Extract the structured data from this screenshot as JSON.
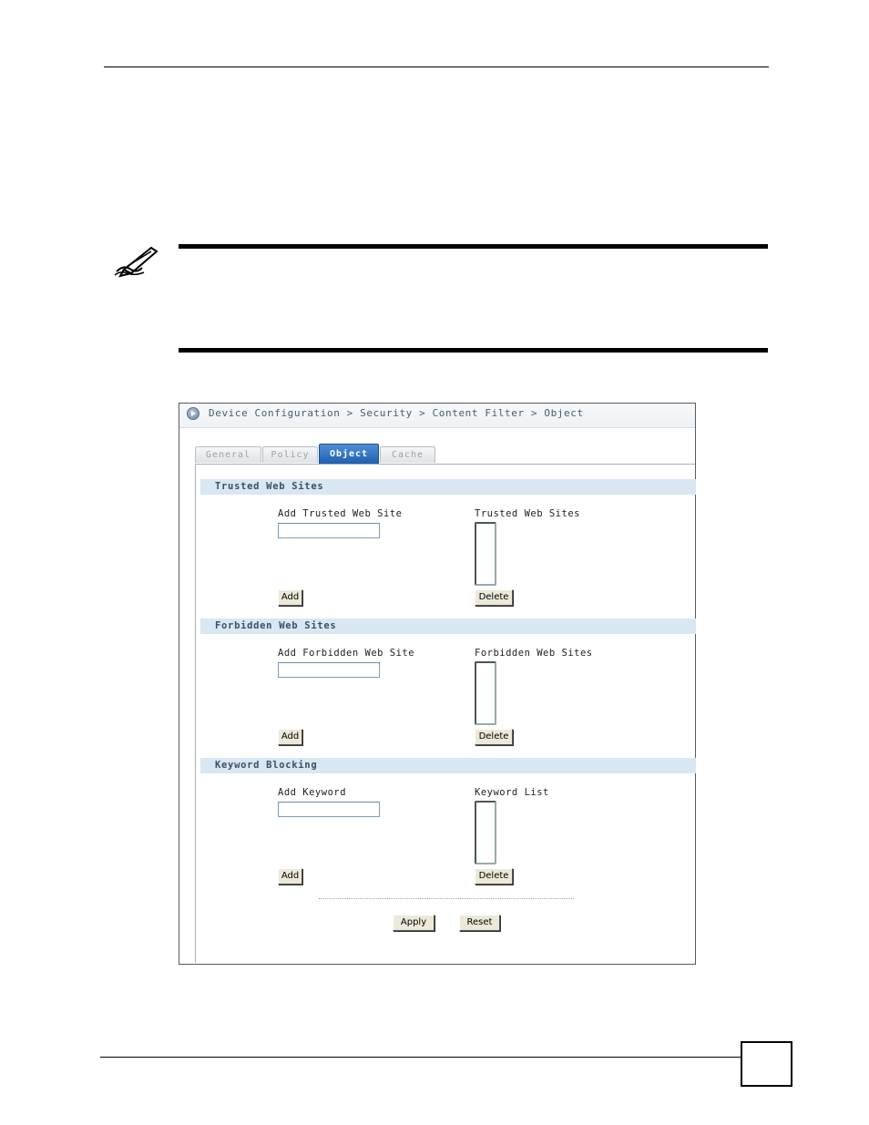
{
  "breadcrumb": {
    "text": "Device Configuration > Security > Content Filter > Object"
  },
  "tabs": [
    {
      "label": "General",
      "active": false
    },
    {
      "label": "Policy",
      "active": false
    },
    {
      "label": "Object",
      "active": true
    },
    {
      "label": "Cache",
      "active": false
    }
  ],
  "sections": {
    "trusted": {
      "header": "Trusted Web Sites",
      "add_label": "Add Trusted Web Site",
      "add_value": "",
      "list_label": "Trusted Web Sites",
      "add_button": "Add",
      "delete_button": "Delete"
    },
    "forbidden": {
      "header": "Forbidden Web Sites",
      "add_label": "Add Forbidden Web Site",
      "add_value": "",
      "list_label": "Forbidden Web Sites",
      "add_button": "Add",
      "delete_button": "Delete"
    },
    "keyword": {
      "header": "Keyword Blocking",
      "add_label": "Add Keyword",
      "add_value": "",
      "list_label": "Keyword List",
      "add_button": "Add",
      "delete_button": "Delete"
    }
  },
  "footer_buttons": {
    "apply": "Apply",
    "reset": "Reset"
  },
  "colors": {
    "active_tab": "#2a6cc0",
    "section_header_bg": "#d8e7f2",
    "section_header_text": "#385066"
  },
  "icons": {
    "note": "pencil-note-icon",
    "breadcrumb": "arrow-circle-icon"
  }
}
